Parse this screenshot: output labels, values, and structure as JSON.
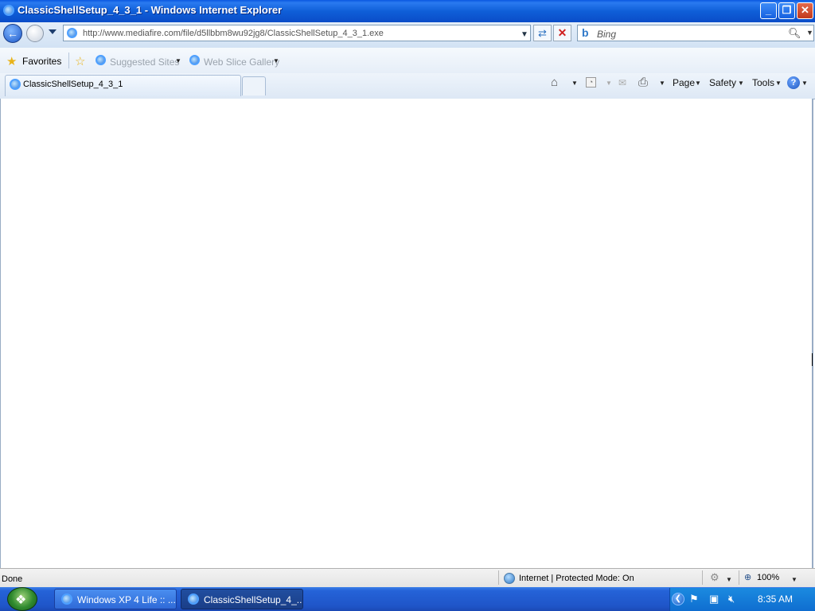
{
  "window": {
    "title": "ClassicShellSetup_4_3_1 - Windows Internet Explorer",
    "minimize": "_",
    "restore": "❐",
    "close": "✕"
  },
  "address": {
    "url": "http://www.mediafire.com/file/d5llbbm8wu92jg8/ClassicShellSetup_4_3_1.exe"
  },
  "search": {
    "placeholder": "Bing",
    "engine_logo": "b"
  },
  "favorites": {
    "label": "Favorites",
    "items": [
      {
        "label": "Suggested Sites"
      },
      {
        "label": "Web Slice Gallery"
      }
    ]
  },
  "tabs": [
    {
      "label": "ClassicShellSetup_4_3_1"
    }
  ],
  "command_bar": {
    "page": "Page",
    "safety": "Safety",
    "tools": "Tools"
  },
  "status": {
    "text": "Done",
    "zone": "Internet | Protected Mode: On",
    "zoom": "100%"
  },
  "taskbar": {
    "tasks": [
      {
        "label": "Windows XP 4 Life :: ..."
      },
      {
        "label": "ClassicShellSetup_4_..."
      }
    ],
    "clock": "8:35 AM"
  },
  "colors": {
    "titlebar": "#0f5fd8",
    "taskbar": "#2563d8",
    "tray": "#0f6ed0"
  },
  "icons": [
    "ie-logo-icon",
    "back-icon",
    "forward-icon",
    "refresh-icon",
    "stop-icon",
    "search-icon",
    "star-icon",
    "add-favorites-icon",
    "home-icon",
    "feeds-icon",
    "read-mail-icon",
    "print-icon",
    "help-icon",
    "globe-icon",
    "zoom-icon",
    "start-orb-icon",
    "flag-icon",
    "network-icon",
    "volume-icon"
  ]
}
